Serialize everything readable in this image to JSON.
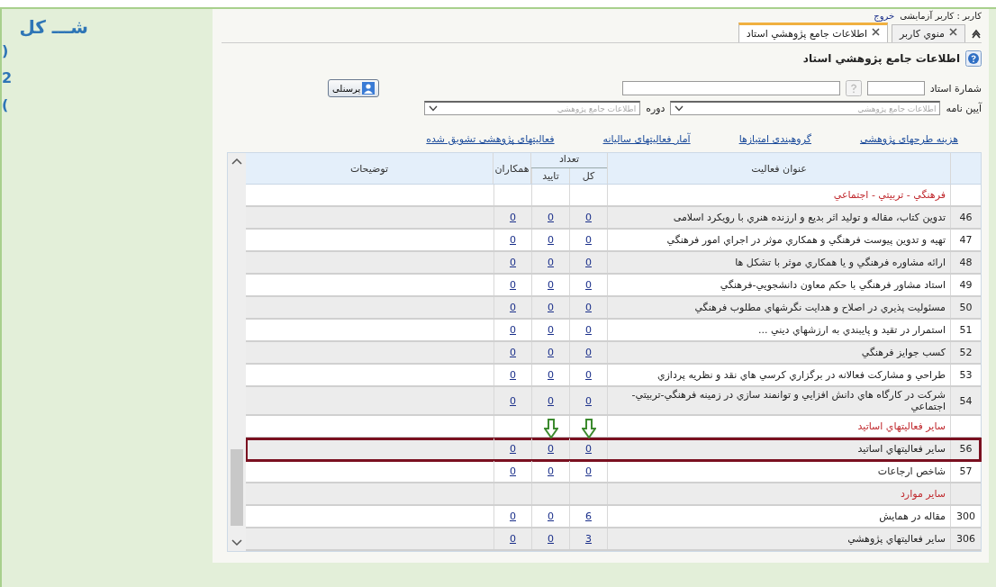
{
  "side_caption": {
    "title": "شـــ کل",
    "marks": [
      ")",
      "2",
      "("
    ]
  },
  "app": {
    "user": {
      "label": "کاربر : کاربر آزمایشی",
      "logout": "خروج"
    },
    "tabs": [
      {
        "label": "منوي کاربر",
        "selected": false
      },
      {
        "label": "اطلاعات جامع پژوهشي استاد",
        "selected": true
      }
    ],
    "page_title": "اطلاعات جامع پژوهشي استاد",
    "form": {
      "professor_number_label": "شمارة استاد",
      "regulation_label": "آیین نامه",
      "regulation_value": "اطلاعات جامع پژوهشي",
      "period_label": "دوره",
      "period_value": "اطلاعات جامع پژوهشي",
      "personnel_button": "پرسنلی"
    },
    "links": [
      "هزینه طرحهای پژوهشی",
      "گروهبندی امتیازها",
      "آمار فعالیتهای سالیانه",
      "فعالیتهای پژوهشی تشویق شده"
    ],
    "table": {
      "columns": {
        "title": "عنوان فعالیت",
        "count": "تعداد",
        "total": "کل",
        "approved": "تایید",
        "colleagues": "همکاران",
        "notes": "توضیحات"
      },
      "rows": [
        {
          "kind": "section",
          "title": "فرهنگي - تربيتي - اجتماعي"
        },
        {
          "kind": "activity",
          "number": "46",
          "title": "تدوین کتاب، مقاله و تولید اثر بدیع و ارزنده هنري با رویکرد اسلامی",
          "total": "0",
          "approved": "0",
          "colleagues": "0",
          "highlighted": false
        },
        {
          "kind": "activity",
          "number": "47",
          "title": "تهيه و تدوين پيوست فرهنگي و همکاري موثر در اجراي امور فرهنگي",
          "total": "0",
          "approved": "0",
          "colleagues": "0",
          "highlighted": false
        },
        {
          "kind": "activity",
          "number": "48",
          "title": "ارائه مشاوره فرهنگي و يا همکاري موثر با تشکل ها",
          "total": "0",
          "approved": "0",
          "colleagues": "0",
          "highlighted": false
        },
        {
          "kind": "activity",
          "number": "49",
          "title": "استاد مشاور فرهنگي با حکم معاون دانشجويي-فرهنگي",
          "total": "0",
          "approved": "0",
          "colleagues": "0",
          "highlighted": false
        },
        {
          "kind": "activity",
          "number": "50",
          "title": "مسئوليت پذيري در اصلاح و هدايت نگرشهاي مطلوب فرهنگي",
          "total": "0",
          "approved": "0",
          "colleagues": "0",
          "highlighted": false
        },
        {
          "kind": "activity",
          "number": "51",
          "title": "استمرار در تقيد و پايبندي به ارزشهاي ديني ...",
          "total": "0",
          "approved": "0",
          "colleagues": "0",
          "highlighted": false
        },
        {
          "kind": "activity",
          "number": "52",
          "title": "کسب جوايز فرهنگي",
          "total": "0",
          "approved": "0",
          "colleagues": "0",
          "highlighted": false
        },
        {
          "kind": "activity",
          "number": "53",
          "title": "طراحي و مشارکت فعالانه در برگزاري کرسي هاي نقد و نظريه پردازي",
          "total": "0",
          "approved": "0",
          "colleagues": "0",
          "highlighted": false
        },
        {
          "kind": "activity",
          "number": "54",
          "title": "شرکت در کارگاه هاي دانش افزايي و توانمند سازي در زمينه فرهنگي-تربيتي-اجتماعي",
          "total": "0",
          "approved": "0",
          "colleagues": "0",
          "highlighted": false
        },
        {
          "kind": "section",
          "title": "ساير فعاليتهاي اساتيد"
        },
        {
          "kind": "activity",
          "number": "56",
          "title": "ساير فعاليتهاي اساتيد",
          "total": "0",
          "approved": "0",
          "colleagues": "0",
          "highlighted": true
        },
        {
          "kind": "activity",
          "number": "57",
          "title": "شاخص ارجاعات",
          "total": "0",
          "approved": "0",
          "colleagues": "0",
          "highlighted": false
        },
        {
          "kind": "section",
          "title": "ساير موارد"
        },
        {
          "kind": "activity",
          "number": "300",
          "title": "مقاله در همايش",
          "total": "6",
          "approved": "0",
          "colleagues": "0",
          "highlighted": false
        },
        {
          "kind": "activity",
          "number": "306",
          "title": "ساير فعاليتهاي پژوهشي",
          "total": "3",
          "approved": "0",
          "colleagues": "0",
          "highlighted": false
        }
      ]
    }
  }
}
